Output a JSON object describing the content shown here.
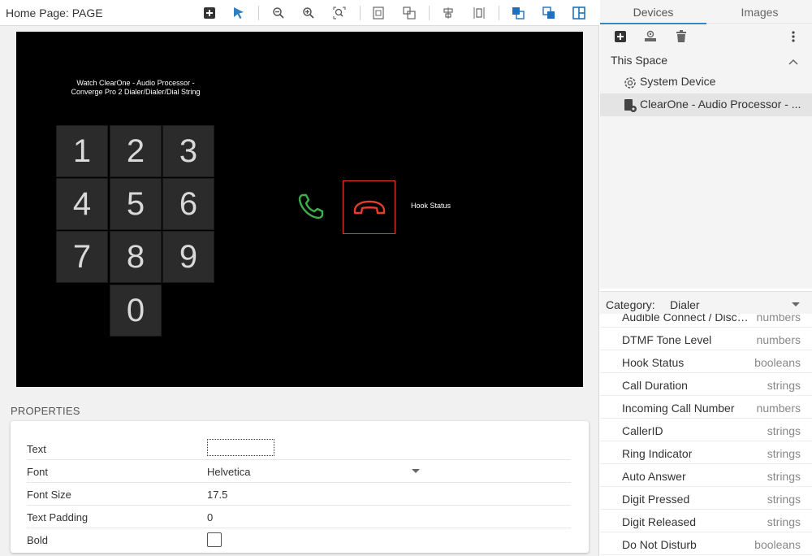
{
  "header": {
    "page_title": "Home Page: PAGE"
  },
  "toolbar_icons": [
    "add-widget-icon",
    "select-arrow-icon",
    "zoom-out-icon",
    "zoom-in-icon",
    "zoom-fit-icon",
    "fit-page-icon",
    "resize-icon",
    "align-center-icon",
    "distribute-icon",
    "bring-to-front-icon",
    "send-to-back-icon",
    "layout-panel-icon"
  ],
  "canvas": {
    "title": "Watch ClearOne - Audio Processor - Converge Pro 2 Dialer/Dialer/Dial String",
    "keys": [
      "1",
      "2",
      "3",
      "4",
      "5",
      "6",
      "7",
      "8",
      "9",
      "0"
    ],
    "hook_label": "Hook Status",
    "colors": {
      "background": "#000000",
      "key": "#2b2b2b",
      "call": "#3fae49",
      "hangup": "#e53c2e"
    }
  },
  "properties": {
    "header": "PROPERTIES",
    "rows": [
      {
        "label": "Text",
        "value": ""
      },
      {
        "label": "Font",
        "value": "Helvetica"
      },
      {
        "label": "Font Size",
        "value": "17.5"
      },
      {
        "label": "Text Padding",
        "value": "0"
      },
      {
        "label": "Bold",
        "value": ""
      }
    ]
  },
  "side": {
    "tabs": [
      "Devices",
      "Images"
    ],
    "space_label": "This Space",
    "devices": [
      {
        "label": "System Device",
        "icon": "gear-icon"
      },
      {
        "label": "ClearOne - Audio Processor - ...",
        "icon": "device-icon"
      }
    ],
    "category_label": "Category:",
    "category_value": "Dialer",
    "attributes": [
      {
        "name": "Audible Connect / Disco...",
        "type": "numbers"
      },
      {
        "name": "DTMF Tone Level",
        "type": "numbers"
      },
      {
        "name": "Hook Status",
        "type": "booleans"
      },
      {
        "name": "Call Duration",
        "type": "strings"
      },
      {
        "name": "Incoming Call Number",
        "type": "numbers"
      },
      {
        "name": "CallerID",
        "type": "strings"
      },
      {
        "name": "Ring Indicator",
        "type": "strings"
      },
      {
        "name": "Auto Answer",
        "type": "strings"
      },
      {
        "name": "Digit Pressed",
        "type": "strings"
      },
      {
        "name": "Digit Released",
        "type": "strings"
      },
      {
        "name": "Do Not Disturb",
        "type": "booleans"
      }
    ]
  }
}
